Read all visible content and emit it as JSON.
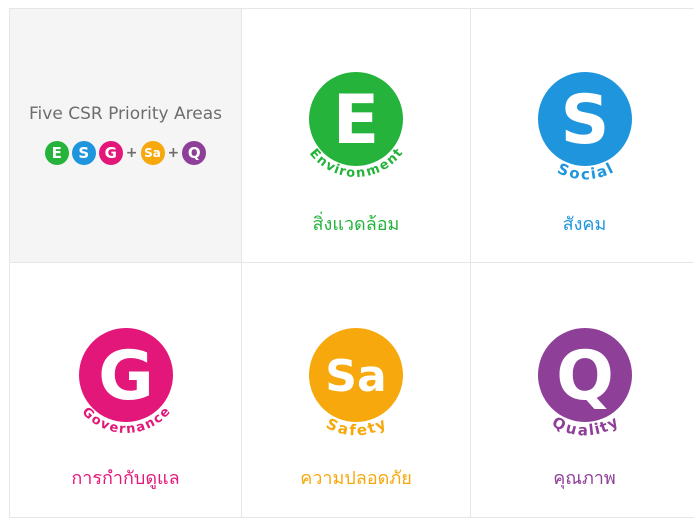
{
  "intro": {
    "title": "Five CSR Priority Areas",
    "badges": [
      {
        "letter": "E",
        "color": "#25b33b"
      },
      {
        "letter": "S",
        "color": "#1e95dd"
      },
      {
        "letter": "G",
        "color": "#e3177a"
      },
      {
        "letter": "Sa",
        "color": "#f6a80c"
      },
      {
        "letter": "Q",
        "color": "#8e3f98"
      }
    ],
    "plus": "+"
  },
  "areas": [
    {
      "key": "environment",
      "letter": "E",
      "arc": "Environment",
      "thai": "สิ่งแวดล้อม",
      "color": "#25b33b"
    },
    {
      "key": "social",
      "letter": "S",
      "arc": "Social",
      "thai": "สังคม",
      "color": "#1e95dd"
    },
    {
      "key": "governance",
      "letter": "G",
      "arc": "Governance",
      "thai": "การกำกับดูแล",
      "color": "#e3177a"
    },
    {
      "key": "safety",
      "letter": "Sa",
      "arc": "Safety",
      "thai": "ความปลอดภัย",
      "color": "#f6a80c"
    },
    {
      "key": "quality",
      "letter": "Q",
      "arc": "Quality",
      "thai": "คุณภาพ",
      "color": "#8e3f98"
    }
  ]
}
